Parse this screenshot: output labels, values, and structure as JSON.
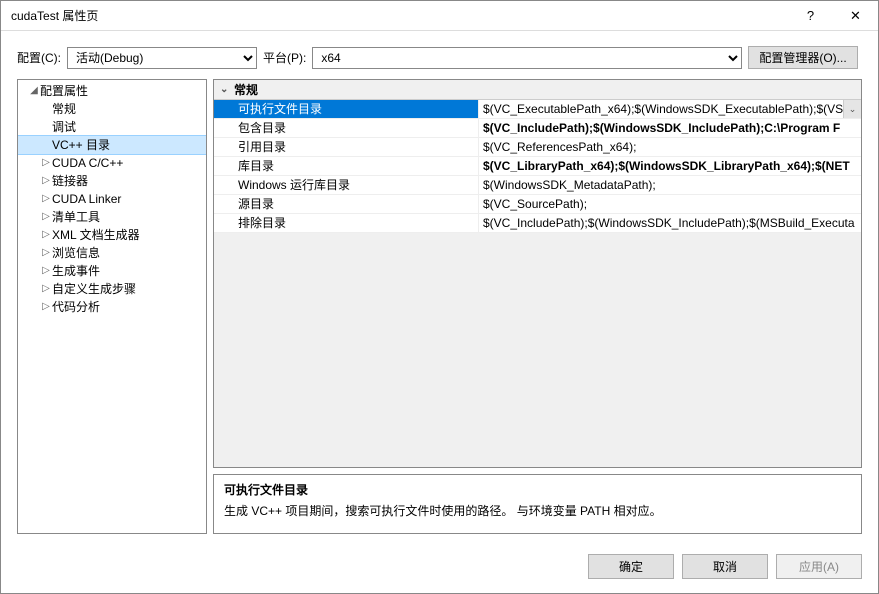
{
  "window": {
    "title": "cudaTest 属性页",
    "help": "?",
    "close": "✕"
  },
  "toolbar": {
    "config_label": "配置(C):",
    "config_value": "活动(Debug)",
    "platform_label": "平台(P):",
    "platform_value": "x64",
    "mgr_button": "配置管理器(O)..."
  },
  "tree": {
    "root": "配置属性",
    "items": [
      {
        "label": "常规",
        "arrow": ""
      },
      {
        "label": "调试",
        "arrow": ""
      },
      {
        "label": "VC++ 目录",
        "arrow": "",
        "selected": true
      },
      {
        "label": "CUDA C/C++",
        "arrow": "▷"
      },
      {
        "label": "链接器",
        "arrow": "▷"
      },
      {
        "label": "CUDA Linker",
        "arrow": "▷"
      },
      {
        "label": "清单工具",
        "arrow": "▷"
      },
      {
        "label": "XML 文档生成器",
        "arrow": "▷"
      },
      {
        "label": "浏览信息",
        "arrow": "▷"
      },
      {
        "label": "生成事件",
        "arrow": "▷"
      },
      {
        "label": "自定义生成步骤",
        "arrow": "▷"
      },
      {
        "label": "代码分析",
        "arrow": "▷"
      }
    ]
  },
  "grid": {
    "section": "常规",
    "rows": [
      {
        "label": "可执行文件目录",
        "value": "$(VC_ExecutablePath_x64);$(WindowsSDK_ExecutablePath);$(VS",
        "selected": true,
        "bold": false
      },
      {
        "label": "包含目录",
        "value": "$(VC_IncludePath);$(WindowsSDK_IncludePath);C:\\Program F",
        "bold": true
      },
      {
        "label": "引用目录",
        "value": "$(VC_ReferencesPath_x64);",
        "bold": false
      },
      {
        "label": "库目录",
        "value": "$(VC_LibraryPath_x64);$(WindowsSDK_LibraryPath_x64);$(NET",
        "bold": true
      },
      {
        "label": "Windows 运行库目录",
        "value": "$(WindowsSDK_MetadataPath);",
        "bold": false
      },
      {
        "label": "源目录",
        "value": "$(VC_SourcePath);",
        "bold": false
      },
      {
        "label": "排除目录",
        "value": "$(VC_IncludePath);$(WindowsSDK_IncludePath);$(MSBuild_Executa",
        "bold": false
      }
    ]
  },
  "desc": {
    "title": "可执行文件目录",
    "text": "生成 VC++ 项目期间，搜索可执行文件时使用的路径。   与环境变量 PATH 相对应。"
  },
  "footer": {
    "ok": "确定",
    "cancel": "取消",
    "apply": "应用(A)"
  }
}
